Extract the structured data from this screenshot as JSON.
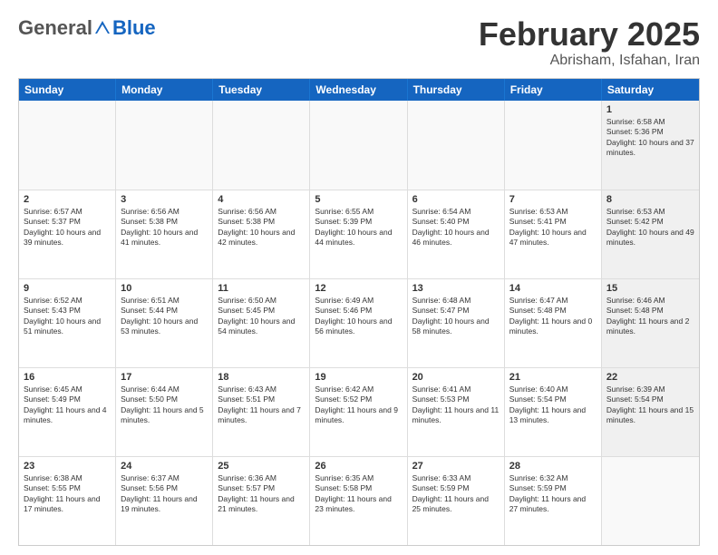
{
  "logo": {
    "general": "General",
    "blue": "Blue"
  },
  "header": {
    "title": "February 2025",
    "subtitle": "Abrisham, Isfahan, Iran"
  },
  "days": [
    "Sunday",
    "Monday",
    "Tuesday",
    "Wednesday",
    "Thursday",
    "Friday",
    "Saturday"
  ],
  "weeks": [
    [
      {
        "day": "",
        "text": "",
        "empty": true
      },
      {
        "day": "",
        "text": "",
        "empty": true
      },
      {
        "day": "",
        "text": "",
        "empty": true
      },
      {
        "day": "",
        "text": "",
        "empty": true
      },
      {
        "day": "",
        "text": "",
        "empty": true
      },
      {
        "day": "",
        "text": "",
        "empty": true
      },
      {
        "day": "1",
        "text": "Sunrise: 6:58 AM\nSunset: 5:36 PM\nDaylight: 10 hours and 37 minutes.",
        "shaded": true
      }
    ],
    [
      {
        "day": "2",
        "text": "Sunrise: 6:57 AM\nSunset: 5:37 PM\nDaylight: 10 hours and 39 minutes."
      },
      {
        "day": "3",
        "text": "Sunrise: 6:56 AM\nSunset: 5:38 PM\nDaylight: 10 hours and 41 minutes."
      },
      {
        "day": "4",
        "text": "Sunrise: 6:56 AM\nSunset: 5:38 PM\nDaylight: 10 hours and 42 minutes."
      },
      {
        "day": "5",
        "text": "Sunrise: 6:55 AM\nSunset: 5:39 PM\nDaylight: 10 hours and 44 minutes."
      },
      {
        "day": "6",
        "text": "Sunrise: 6:54 AM\nSunset: 5:40 PM\nDaylight: 10 hours and 46 minutes."
      },
      {
        "day": "7",
        "text": "Sunrise: 6:53 AM\nSunset: 5:41 PM\nDaylight: 10 hours and 47 minutes."
      },
      {
        "day": "8",
        "text": "Sunrise: 6:53 AM\nSunset: 5:42 PM\nDaylight: 10 hours and 49 minutes.",
        "shaded": true
      }
    ],
    [
      {
        "day": "9",
        "text": "Sunrise: 6:52 AM\nSunset: 5:43 PM\nDaylight: 10 hours and 51 minutes."
      },
      {
        "day": "10",
        "text": "Sunrise: 6:51 AM\nSunset: 5:44 PM\nDaylight: 10 hours and 53 minutes."
      },
      {
        "day": "11",
        "text": "Sunrise: 6:50 AM\nSunset: 5:45 PM\nDaylight: 10 hours and 54 minutes."
      },
      {
        "day": "12",
        "text": "Sunrise: 6:49 AM\nSunset: 5:46 PM\nDaylight: 10 hours and 56 minutes."
      },
      {
        "day": "13",
        "text": "Sunrise: 6:48 AM\nSunset: 5:47 PM\nDaylight: 10 hours and 58 minutes."
      },
      {
        "day": "14",
        "text": "Sunrise: 6:47 AM\nSunset: 5:48 PM\nDaylight: 11 hours and 0 minutes."
      },
      {
        "day": "15",
        "text": "Sunrise: 6:46 AM\nSunset: 5:48 PM\nDaylight: 11 hours and 2 minutes.",
        "shaded": true
      }
    ],
    [
      {
        "day": "16",
        "text": "Sunrise: 6:45 AM\nSunset: 5:49 PM\nDaylight: 11 hours and 4 minutes."
      },
      {
        "day": "17",
        "text": "Sunrise: 6:44 AM\nSunset: 5:50 PM\nDaylight: 11 hours and 5 minutes."
      },
      {
        "day": "18",
        "text": "Sunrise: 6:43 AM\nSunset: 5:51 PM\nDaylight: 11 hours and 7 minutes."
      },
      {
        "day": "19",
        "text": "Sunrise: 6:42 AM\nSunset: 5:52 PM\nDaylight: 11 hours and 9 minutes."
      },
      {
        "day": "20",
        "text": "Sunrise: 6:41 AM\nSunset: 5:53 PM\nDaylight: 11 hours and 11 minutes."
      },
      {
        "day": "21",
        "text": "Sunrise: 6:40 AM\nSunset: 5:54 PM\nDaylight: 11 hours and 13 minutes."
      },
      {
        "day": "22",
        "text": "Sunrise: 6:39 AM\nSunset: 5:54 PM\nDaylight: 11 hours and 15 minutes.",
        "shaded": true
      }
    ],
    [
      {
        "day": "23",
        "text": "Sunrise: 6:38 AM\nSunset: 5:55 PM\nDaylight: 11 hours and 17 minutes."
      },
      {
        "day": "24",
        "text": "Sunrise: 6:37 AM\nSunset: 5:56 PM\nDaylight: 11 hours and 19 minutes."
      },
      {
        "day": "25",
        "text": "Sunrise: 6:36 AM\nSunset: 5:57 PM\nDaylight: 11 hours and 21 minutes."
      },
      {
        "day": "26",
        "text": "Sunrise: 6:35 AM\nSunset: 5:58 PM\nDaylight: 11 hours and 23 minutes."
      },
      {
        "day": "27",
        "text": "Sunrise: 6:33 AM\nSunset: 5:59 PM\nDaylight: 11 hours and 25 minutes."
      },
      {
        "day": "28",
        "text": "Sunrise: 6:32 AM\nSunset: 5:59 PM\nDaylight: 11 hours and 27 minutes."
      },
      {
        "day": "",
        "text": "",
        "empty": true
      }
    ]
  ]
}
